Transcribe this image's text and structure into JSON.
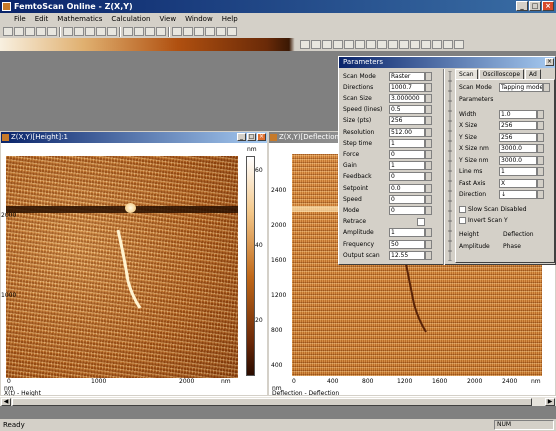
{
  "app": {
    "title": "FemtoScan Online - Z(X,Y)"
  },
  "window_buttons": {
    "minimize": "_",
    "maximize": "□",
    "close": "×"
  },
  "menu": [
    "File",
    "Edit",
    "Mathematics",
    "Calculation",
    "View",
    "Window",
    "Help"
  ],
  "toolbar1_icons": [
    "new-icon",
    "open-icon",
    "save-icon",
    "print-icon",
    "cut-icon",
    "copy-icon",
    "paste-icon",
    "undo-icon",
    "redo-icon",
    "help-icon",
    "grid-icon",
    "graph-icon",
    "measure-icon",
    "zoom-in-icon",
    "zoom-out-icon",
    "fit-icon",
    "settings-icon",
    "color-icon",
    "contrast-icon",
    "3d-icon"
  ],
  "toolbar2_icons": [
    "line-icon",
    "profile-icon",
    "section-icon",
    "area-icon",
    "filter-icon",
    "level-icon",
    "fft-icon",
    "histogram-icon",
    "text-icon",
    "arrow-icon",
    "rotate-icon",
    "flip-icon",
    "crop-icon",
    "scale-icon",
    "export-icon"
  ],
  "window_left": {
    "title": "Z(X,Y)[Height]:1",
    "colorbar_unit": "nm",
    "colorbar_ticks": [
      "60",
      "40",
      "20"
    ],
    "y_ticks": [
      "2000",
      "1000"
    ],
    "x_ticks": [
      "0",
      "1000",
      "2000"
    ],
    "x_unit": "nm",
    "info_line1": "nm",
    "info_line2": "X(t) - Height"
  },
  "window_right": {
    "title": "Z(X,Y)[Deflection]:1",
    "y_ticks": [
      "2400",
      "2000",
      "1600",
      "1200",
      "800",
      "400"
    ],
    "x_ticks": [
      "0",
      "400",
      "800",
      "1200",
      "1600",
      "2000",
      "2400"
    ],
    "x_unit": "nm",
    "info_line1": "nm",
    "info_line2": "Deflection - Deflection"
  },
  "params_panel": {
    "title": "Parameters",
    "close": "×",
    "left_rows": [
      {
        "label": "Scan Mode",
        "value": "Raster"
      },
      {
        "label": "Directions",
        "value": "1000.7"
      },
      {
        "label": "Scan Size",
        "value": "3.000000"
      },
      {
        "label": "Speed (lines)",
        "value": "0.5"
      },
      {
        "label": "Size (pts)",
        "value": "256"
      },
      {
        "label": "Resolution",
        "value": "512.00"
      },
      {
        "label": "Step time",
        "value": "1"
      },
      {
        "label": "Force",
        "value": "0"
      },
      {
        "label": "Gain",
        "value": "1"
      },
      {
        "label": "Feedback",
        "value": "0"
      },
      {
        "label": "Setpoint",
        "value": "0.0"
      },
      {
        "label": "Speed",
        "value": "0"
      },
      {
        "label": "Mode",
        "value": "0"
      },
      {
        "label": "Retrace",
        "value": ""
      },
      {
        "label": "Amplitude",
        "value": "1"
      },
      {
        "label": "Frequency",
        "value": "50"
      },
      {
        "label": "Output scan",
        "value": "12.55"
      }
    ],
    "tabs": [
      "Scan",
      "Oscilloscope",
      "Ad"
    ],
    "active_tab": "Scan",
    "scan_mode_label": "Scan Mode",
    "scan_mode_value": "Tapping mode",
    "parameters_label": "Parameters",
    "right_rows": [
      {
        "label": "Width",
        "value": "1.0"
      },
      {
        "label": "X Size",
        "value": "256"
      },
      {
        "label": "Y Size",
        "value": "256"
      },
      {
        "label": "X Size nm",
        "value": "3000.0"
      },
      {
        "label": "Y Size nm",
        "value": "3000.0"
      },
      {
        "label": "Line ms",
        "value": "1"
      },
      {
        "label": "Fast Axis",
        "value": "X"
      },
      {
        "label": "Direction",
        "value": "↓"
      }
    ],
    "options": [
      "Slow Scan Disabled",
      "Invert Scan Y"
    ],
    "bottom_labels": [
      "Height",
      "Deflection",
      "Amplitude",
      "Phase"
    ]
  },
  "statusbar": {
    "text": "Ready",
    "panel": "NUM"
  }
}
